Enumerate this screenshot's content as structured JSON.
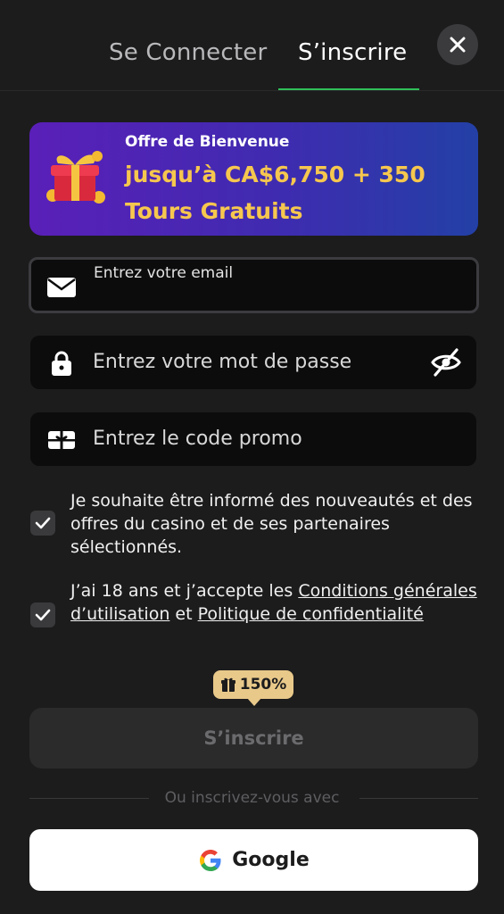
{
  "tabs": {
    "login": "Se Connecter",
    "register": "S’inscrire",
    "active": "register"
  },
  "banner": {
    "title": "Offre de Bienvenue",
    "offer_line1": "jusqu’à CA$6,750 + 350",
    "offer_line2": "Tours Gratuits"
  },
  "form": {
    "email": {
      "label": "Entrez votre email",
      "value": "",
      "icon": "envelope-icon"
    },
    "password": {
      "placeholder": "Entrez votre mot de passe",
      "icon": "lock-icon",
      "toggle_icon": "eye-off-icon"
    },
    "promo": {
      "placeholder": "Entrez le code promo",
      "icon": "gift-card-icon"
    }
  },
  "consents": {
    "marketing": {
      "checked": true,
      "text": "Je souhaite être informé des nouveautés et des offres du casino et de ses partenaires sélectionnés."
    },
    "terms": {
      "checked": true,
      "prefix": "J’ai 18 ans et j’accepte les ",
      "terms_link": "Conditions générales d’utilisation",
      "joiner": " et ",
      "privacy_link": "Politique de confidentialité"
    }
  },
  "bonus_badge": {
    "text": "150%",
    "icon": "gift-icon"
  },
  "submit_label": "S’inscrire",
  "divider_text": "Ou inscrivez-vous avec",
  "google_label": "Google",
  "colors": {
    "background": "#1c1c1d",
    "accent_green": "#2fbf5a",
    "offer_gold": "#f6c74e",
    "badge": "#e9c98a"
  }
}
